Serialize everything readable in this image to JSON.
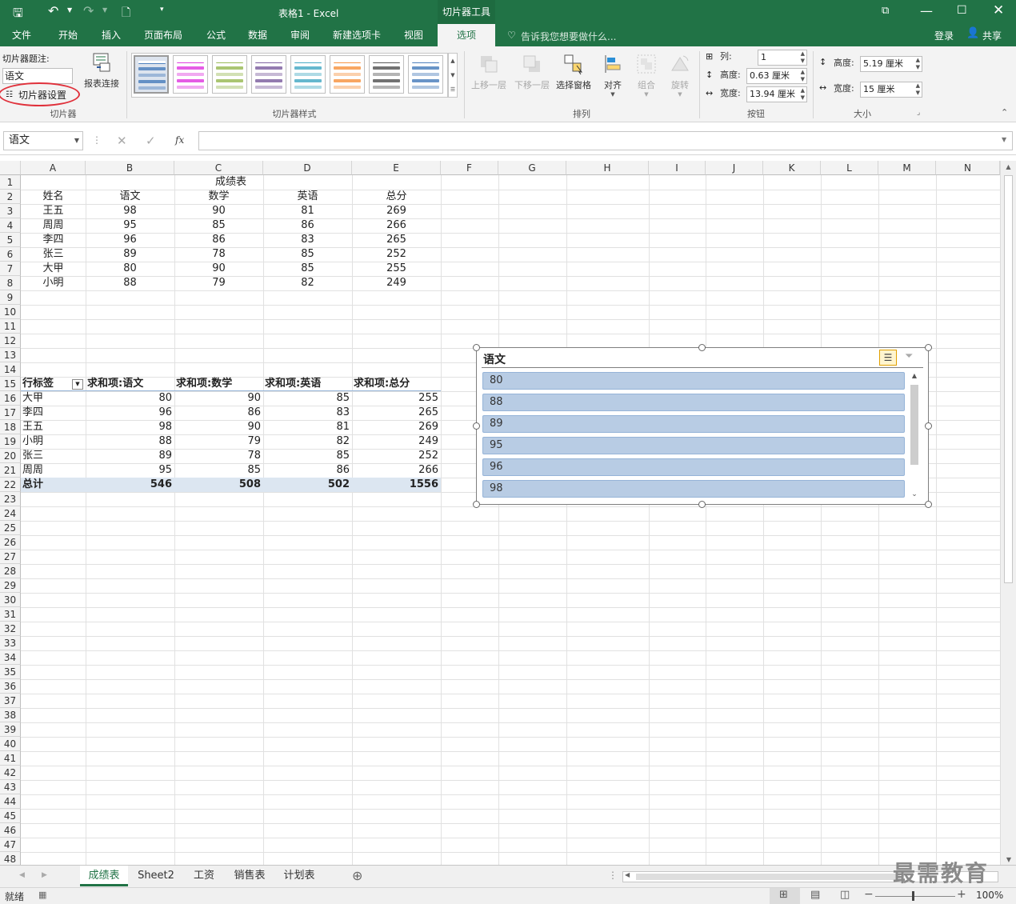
{
  "titlebar": {
    "doc_title": "表格1 - Excel",
    "context_tab": "切片器工具",
    "ribbon_options_icon": "ribbon-display-icon"
  },
  "tabs": [
    "文件",
    "开始",
    "插入",
    "页面布局",
    "公式",
    "数据",
    "审阅",
    "新建选项卡",
    "视图",
    "选项"
  ],
  "active_tab": "选项",
  "tellme": "告诉我您想要做什么...",
  "signin": "登录",
  "share": "共享",
  "ribbon": {
    "slicer_caption_label": "切片器题注:",
    "slicer_caption_value": "语文",
    "slicer_settings": "切片器设置",
    "report_connections": "报表连接",
    "group_slicer": "切片器",
    "group_styles": "切片器样式",
    "raise": "上移一层",
    "lower": "下移一层",
    "selection_pane": "选择窗格",
    "align": "对齐",
    "group": "组合",
    "rotate": "旋转",
    "group_arrange": "排列",
    "columns_label": "列:",
    "columns_value": "1",
    "btn_height_label": "高度:",
    "btn_height_value": "0.63 厘米",
    "btn_width_label": "宽度:",
    "btn_width_value": "13.94 厘米",
    "group_buttons": "按钮",
    "size_height_label": "高度:",
    "size_height_value": "5.19 厘米",
    "size_width_label": "宽度:",
    "size_width_value": "15 厘米",
    "group_size": "大小",
    "style_colors": [
      "#4f81bd",
      "#e040e0",
      "#9bbb59",
      "#8064a2",
      "#4bacc6",
      "#f79646",
      "#595959",
      "#4f81bd"
    ]
  },
  "formula_bar": {
    "name_box": "语文",
    "fx": "fx",
    "value": ""
  },
  "columns": [
    "A",
    "B",
    "C",
    "D",
    "E",
    "F",
    "G",
    "H",
    "I",
    "J",
    "K",
    "L",
    "M",
    "N"
  ],
  "rows": [
    "1",
    "2",
    "3",
    "4",
    "5",
    "6",
    "7",
    "8",
    "9",
    "10",
    "11",
    "12",
    "13",
    "14",
    "15",
    "16",
    "17",
    "18",
    "19",
    "20",
    "21",
    "22",
    "23",
    "24",
    "25",
    "26",
    "27",
    "28",
    "29",
    "30",
    "31",
    "32",
    "33",
    "34",
    "35",
    "36",
    "37",
    "38",
    "39",
    "40",
    "41",
    "42",
    "43",
    "44",
    "45",
    "46",
    "47",
    "48"
  ],
  "table": {
    "title": "成绩表",
    "headers": [
      "姓名",
      "语文",
      "数学",
      "英语",
      "总分"
    ],
    "rows": [
      [
        "王五",
        "98",
        "90",
        "81",
        "269"
      ],
      [
        "周周",
        "95",
        "85",
        "86",
        "266"
      ],
      [
        "李四",
        "96",
        "86",
        "83",
        "265"
      ],
      [
        "张三",
        "89",
        "78",
        "85",
        "252"
      ],
      [
        "大甲",
        "80",
        "90",
        "85",
        "255"
      ],
      [
        "小明",
        "88",
        "79",
        "82",
        "249"
      ]
    ]
  },
  "pivot": {
    "headers": [
      "行标签",
      "求和项:语文",
      "求和项:数学",
      "求和项:英语",
      "求和项:总分"
    ],
    "rows": [
      [
        "大甲",
        "80",
        "90",
        "85",
        "255"
      ],
      [
        "李四",
        "96",
        "86",
        "83",
        "265"
      ],
      [
        "王五",
        "98",
        "90",
        "81",
        "269"
      ],
      [
        "小明",
        "88",
        "79",
        "82",
        "249"
      ],
      [
        "张三",
        "89",
        "78",
        "85",
        "252"
      ],
      [
        "周周",
        "95",
        "85",
        "86",
        "266"
      ]
    ],
    "total": [
      "总计",
      "546",
      "508",
      "502",
      "1556"
    ]
  },
  "slicer": {
    "title": "语文",
    "items": [
      "80",
      "88",
      "89",
      "95",
      "96",
      "98"
    ]
  },
  "sheets": [
    "成绩表",
    "Sheet2",
    "工资",
    "销售表",
    "计划表"
  ],
  "active_sheet": "成绩表",
  "status": {
    "ready": "就绪",
    "zoom": "100%"
  },
  "watermark": "最需教育"
}
